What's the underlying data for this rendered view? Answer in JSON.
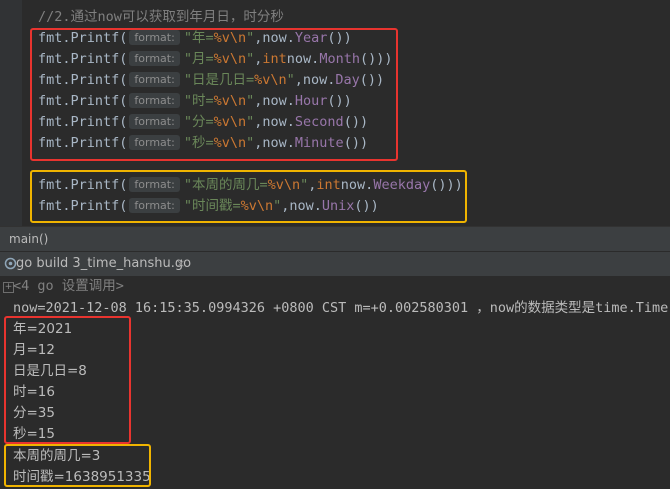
{
  "editor": {
    "comment": "//2.通过now可以获取到年月日，时分秒",
    "hint_label": "format:",
    "lines": [
      {
        "fn": "fmt.Printf(",
        "str_pre": "\"年=",
        "str_fmt": "%v",
        "str_esc": "\\n",
        "str_post": "\"",
        "rest_pre": ",now.",
        "kw": "",
        "field": "Year",
        "rest_post": "())"
      },
      {
        "fn": "fmt.Printf(",
        "str_pre": "\"月=",
        "str_fmt": "%v",
        "str_esc": "\\n",
        "str_post": "\"",
        "rest_pre": ",",
        "kw": "int",
        "field": "now.Month",
        "rest_post": "()))"
      },
      {
        "fn": "fmt.Printf(",
        "str_pre": "\"日是几日=",
        "str_fmt": "%v",
        "str_esc": "\\n",
        "str_post": "\"",
        "rest_pre": ",now.",
        "kw": "",
        "field": "Day",
        "rest_post": "())"
      },
      {
        "fn": "fmt.Printf(",
        "str_pre": "\"时=",
        "str_fmt": "%v",
        "str_esc": "\\n",
        "str_post": "\"",
        "rest_pre": ",now.",
        "kw": "",
        "field": "Hour",
        "rest_post": "())"
      },
      {
        "fn": "fmt.Printf(",
        "str_pre": "\"分=",
        "str_fmt": "%v",
        "str_esc": "\\n",
        "str_post": "\"",
        "rest_pre": ",now.",
        "kw": "",
        "field": "Second",
        "rest_post": "())"
      },
      {
        "fn": "fmt.Printf(",
        "str_pre": "\"秒=",
        "str_fmt": "%v",
        "str_esc": "\\n",
        "str_post": "\"",
        "rest_pre": ",now.",
        "kw": "",
        "field": "Minute",
        "rest_post": "())"
      },
      {
        "fn": "fmt.Printf(",
        "str_pre": "\"本周的周几=",
        "str_fmt": "%v",
        "str_esc": "\\n",
        "str_post": "\"",
        "rest_pre": ",",
        "kw": "int",
        "field": "now.Weekday",
        "rest_post": "()))"
      },
      {
        "fn": "fmt.Printf(",
        "str_pre": "\"时间戳=",
        "str_fmt": "%v",
        "str_esc": "\\n",
        "str_post": "\"",
        "rest_pre": ",now.",
        "kw": "",
        "field": "Unix",
        "rest_post": "())"
      }
    ]
  },
  "breadcrumb": {
    "label": "main()"
  },
  "run_tab": {
    "title": "go build 3_time_hanshu.go",
    "close": "×"
  },
  "console": {
    "fold_label": "<4 go 设置调用>",
    "fold_sign": "+",
    "now_line": "now=2021-12-08 16:15:35.0994326 +0800 CST m=+0.002580301 ，now的数据类型是time.Time",
    "output": [
      "年=2021",
      "月=12",
      "日是几日=8",
      "时=16",
      "分=35",
      "秒=15",
      "本周的周几=3",
      "时间戳=1638951335"
    ]
  },
  "colors": {
    "red_box": "#e8342f",
    "yellow_box": "#f0b400",
    "string": "#6a8759",
    "keyword": "#cc7832",
    "field": "#9876aa"
  }
}
